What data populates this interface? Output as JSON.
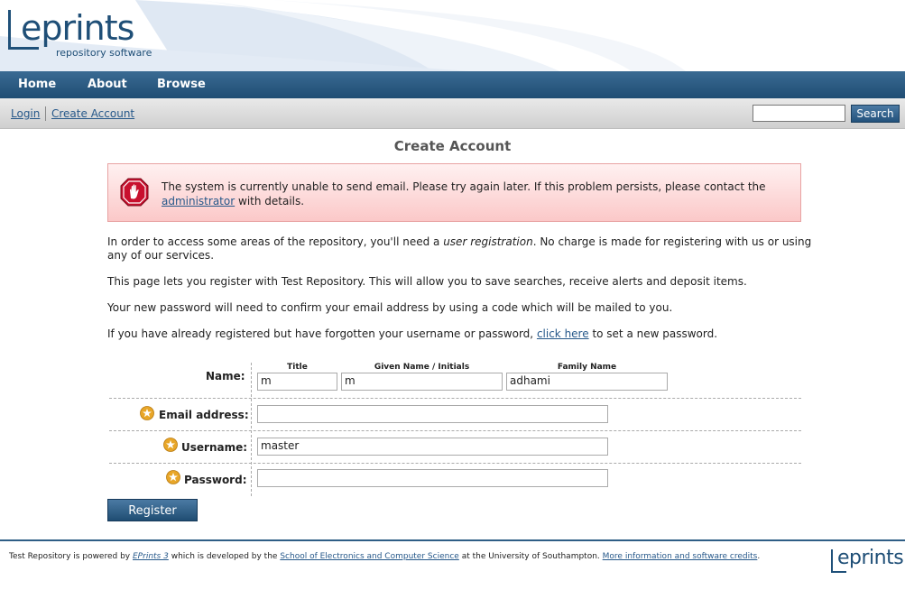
{
  "brand": {
    "logo_text": "eprints",
    "logo_sub": "repository software",
    "footer_logo_text": "eprints"
  },
  "nav": {
    "home": "Home",
    "about": "About",
    "browse": "Browse"
  },
  "subbar": {
    "login": "Login",
    "create_account": "Create Account",
    "search_value": "",
    "search_button": "Search"
  },
  "page_title": "Create Account",
  "alert": {
    "text_before": "The system is currently unable to send email. Please try again later. If this problem persists, please contact the",
    "link": "administrator",
    "text_after": "with details."
  },
  "intro": {
    "p1_before": "In order to access some areas of the repository, you'll need a",
    "p1_em": "user registration",
    "p1_after": ". No charge is made for registering with us or using any of our services.",
    "p2": "This page lets you register with Test Repository. This will allow you to save searches, receive alerts and deposit items.",
    "p3": "Your new password will need to confirm your email address by using a code which will be mailed to you.",
    "p4_before": "If you have already registered but have forgotten your username or password,",
    "p4_link": "click here",
    "p4_after": "to set a new password."
  },
  "form": {
    "name_label": "Name:",
    "title_label": "Title",
    "given_label": "Given Name / Initials",
    "family_label": "Family Name",
    "title_value": "m",
    "given_value": "m",
    "family_value": "adhami",
    "email_label": "Email address:",
    "email_value": "",
    "username_label": "Username:",
    "username_value": "master",
    "password_label": "Password:",
    "password_value": "",
    "register_button": "Register"
  },
  "footer": {
    "t1": "Test Repository is powered by",
    "l1": "EPrints 3",
    "t2": "which is developed by the",
    "l2": "School of Electronics and Computer Science",
    "t3": "at the University of Southampton.",
    "l3": "More information and software credits",
    "t4": "."
  },
  "colors": {
    "nav": "#2a5a82",
    "accent": "#26588a",
    "alert_bg": "#fbd0d0",
    "required_star": "#e8a628"
  },
  "icons": {
    "alert": "stop-hand-icon",
    "required": "required-star-icon"
  }
}
